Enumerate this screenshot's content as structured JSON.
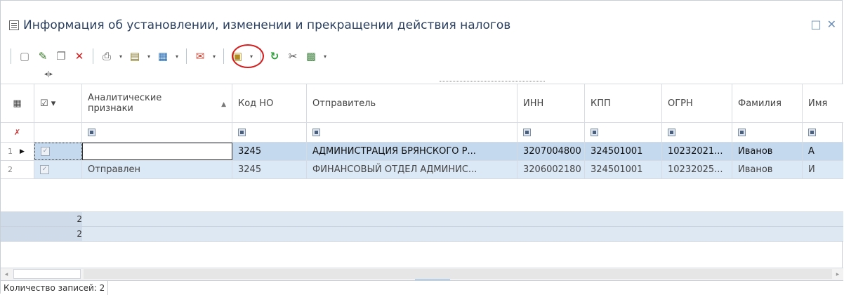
{
  "window": {
    "title": "Информация об установлении, изменении и прекращении действия налогов",
    "restore_glyph": "□",
    "close_glyph": "✕"
  },
  "toolbar": {
    "icons": [
      "new-icon",
      "edit-icon",
      "copy-icon",
      "delete-icon",
      "print-icon",
      "export-icon",
      "import-icon",
      "send-icon",
      "report-icon",
      "refresh-icon",
      "settings-icon",
      "table-icon"
    ],
    "collapse_glyph": "◂|▸",
    "highlighted_button": "send-icon",
    "highlight_color": "#d41c1c"
  },
  "grid": {
    "columns": [
      {
        "key": "select",
        "label": "☑ ▾"
      },
      {
        "key": "attrs",
        "label": "Аналитические признаки"
      },
      {
        "key": "kod_no",
        "label": "Код НО"
      },
      {
        "key": "sender",
        "label": "Отправитель"
      },
      {
        "key": "inn",
        "label": "ИНН"
      },
      {
        "key": "kpp",
        "label": "КПП"
      },
      {
        "key": "ogrn",
        "label": "ОГРН"
      },
      {
        "key": "surname",
        "label": "Фамилия"
      },
      {
        "key": "name",
        "label": "Имя"
      }
    ],
    "rows": [
      {
        "num": "1",
        "attrs": "",
        "kod_no": "3245",
        "sender": "АДМИНИСТРАЦИЯ  БРЯНСКОГО  Р...",
        "inn": "3207004800",
        "kpp": "324501001",
        "ogrn": "10232021...",
        "surname": "Иванов",
        "name": "А"
      },
      {
        "num": "2",
        "attrs": "Отправлен",
        "kod_no": "3245",
        "sender": "ФИНАНСОВЫЙ  ОТДЕЛ  АДМИНИС...",
        "inn": "3206002180",
        "kpp": "324501001",
        "ogrn": "10232025...",
        "surname": "Иванов",
        "name": "И"
      }
    ],
    "summary_counts": [
      "2",
      "2"
    ],
    "selected_row_color": "#c5d9ee",
    "row_color": "#dbe8f5"
  },
  "statusbar": {
    "records_text": "Количество записей: 2"
  }
}
